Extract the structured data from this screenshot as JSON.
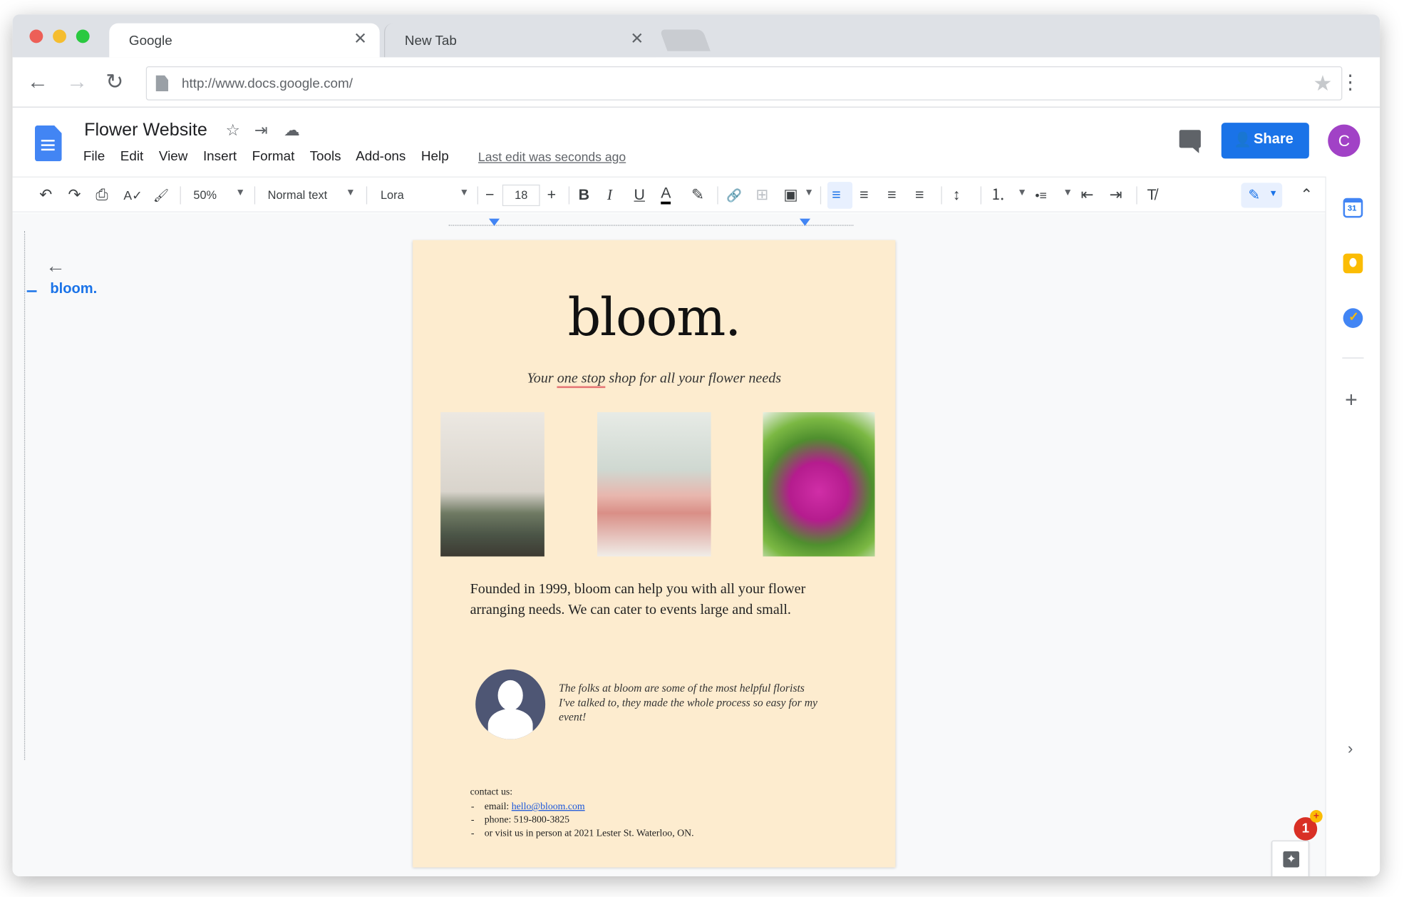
{
  "browser": {
    "tabs": [
      {
        "title": "Google",
        "close": "✕"
      },
      {
        "title": "New Tab",
        "close": "✕"
      }
    ],
    "nav": {
      "back": "←",
      "forward": "→",
      "reload": "↻"
    },
    "url": "http://www.docs.google.com/",
    "bookmark_star": "★",
    "menu": "⋮"
  },
  "docs": {
    "title": "Flower Website",
    "title_icons": {
      "star": "☆",
      "move": "⇥",
      "cloud": "☁"
    },
    "menu": [
      "File",
      "Edit",
      "View",
      "Insert",
      "Format",
      "Tools",
      "Add-ons",
      "Help"
    ],
    "last_edit": "Last edit was seconds ago",
    "share_label": "Share",
    "share_icon": "👤",
    "avatar_letter": "C",
    "accent_color": "#1a73e8"
  },
  "toolbar": {
    "undo": "↶",
    "redo": "↷",
    "print": "⎙",
    "spell": "A✓",
    "paint": "🖌",
    "zoom": "50%",
    "style": "Normal text",
    "font": "Lora",
    "size_minus": "−",
    "size": "18",
    "size_plus": "+",
    "bold": "B",
    "italic": "I",
    "underline": "U",
    "text_color": "A",
    "highlight": "✎",
    "link": "🔗",
    "comment": "⊞",
    "image": "▣",
    "align_left": "≡",
    "align_center": "≡",
    "align_right": "≡",
    "justify": "≡",
    "line_spacing": "↕",
    "numbered_list": "⒈",
    "bulleted_list": "•≡",
    "indent_less": "⇤",
    "indent_more": "⇥",
    "clear_format": "T̸",
    "edit_mode": "✎",
    "collapse": "⌃"
  },
  "outline": {
    "back": "←",
    "heading": "bloom."
  },
  "document": {
    "title": "bloom.",
    "subtitle_before": "Your ",
    "subtitle_squiggle": "one stop",
    "subtitle_after": " shop for all your flower needs",
    "body": "Founded in 1999, bloom can help you with all your flower arranging needs. We can cater to events large and small.",
    "testimonial": "The folks at bloom are some of the most helpful florists I've talked to, they made the whole process so easy for my event!",
    "contact_heading": "contact us:",
    "contact_email_label": "email: ",
    "contact_email": "hello@bloom.com",
    "contact_phone": "phone: 519-800-3825",
    "contact_visit": "or visit us in person at 2021 Lester St. Waterloo, ON.",
    "page_color": "#fdeccf"
  },
  "side_panel": {
    "add": "+",
    "expand": "›"
  },
  "explore": {
    "badge": "1",
    "badge_plus": "+",
    "icon": "✦"
  }
}
